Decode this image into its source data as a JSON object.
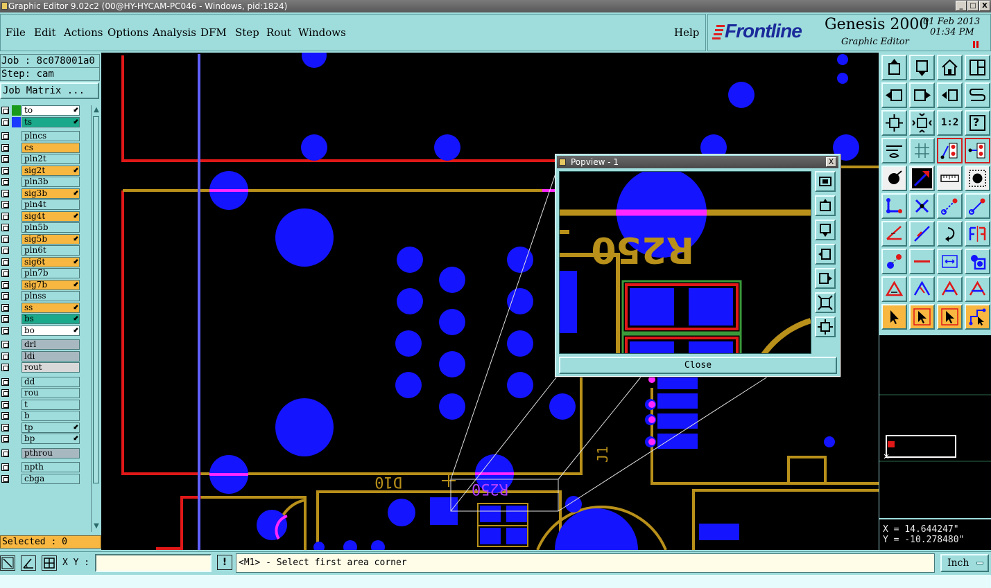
{
  "window": {
    "title": "Graphic Editor 9.02c2 (00@HY-HYCAM-PC046 - Windows, pid:1824)",
    "min_label": "_",
    "max_label": "□",
    "close_label": "X"
  },
  "menu": {
    "file": "File",
    "edit": "Edit",
    "actions": "Actions",
    "options": "Options",
    "analysis": "Analysis",
    "dfm": "DFM",
    "step": "Step",
    "rout": "Rout",
    "windows": "Windows",
    "help": "Help"
  },
  "brand": {
    "logo": "Frontline",
    "product": "Genesis 2000",
    "subtitle": "Graphic Editor",
    "date": "01 Feb 2013",
    "time": "01:34 PM"
  },
  "job": {
    "job_line": "Job : 8c078001a0",
    "step_line": "Step: cam",
    "matrix_button": "Job Matrix ..."
  },
  "layers": [
    {
      "name": "to",
      "color": "#ffffff",
      "swatch": "#1a9a1a",
      "arrow": true
    },
    {
      "name": "ts",
      "color": "#1aa98a",
      "swatch": "#1a3aff",
      "arrow": true
    },
    {
      "name": "plncs",
      "color": "#9fdcdc",
      "swatch": "",
      "arrow": false
    },
    {
      "name": "cs",
      "color": "#f7b740",
      "swatch": "",
      "arrow": false
    },
    {
      "name": "pln2t",
      "color": "#9fdcdc",
      "swatch": "",
      "arrow": false
    },
    {
      "name": "sig2t",
      "color": "#f7b740",
      "swatch": "",
      "arrow": true
    },
    {
      "name": "pln3b",
      "color": "#9fdcdc",
      "swatch": "",
      "arrow": false
    },
    {
      "name": "sig3b",
      "color": "#f7b740",
      "swatch": "",
      "arrow": true
    },
    {
      "name": "pln4t",
      "color": "#9fdcdc",
      "swatch": "",
      "arrow": false
    },
    {
      "name": "sig4t",
      "color": "#f7b740",
      "swatch": "",
      "arrow": true
    },
    {
      "name": "pln5b",
      "color": "#9fdcdc",
      "swatch": "",
      "arrow": false
    },
    {
      "name": "sig5b",
      "color": "#f7b740",
      "swatch": "",
      "arrow": true
    },
    {
      "name": "pln6t",
      "color": "#9fdcdc",
      "swatch": "",
      "arrow": false
    },
    {
      "name": "sig6t",
      "color": "#f7b740",
      "swatch": "",
      "arrow": true
    },
    {
      "name": "pln7b",
      "color": "#9fdcdc",
      "swatch": "",
      "arrow": false
    },
    {
      "name": "sig7b",
      "color": "#f7b740",
      "swatch": "",
      "arrow": true
    },
    {
      "name": "plnss",
      "color": "#9fdcdc",
      "swatch": "",
      "arrow": false
    },
    {
      "name": "ss",
      "color": "#f7b740",
      "swatch": "",
      "arrow": true
    },
    {
      "name": "bs",
      "color": "#1aa98a",
      "swatch": "",
      "arrow": true
    },
    {
      "name": "bo",
      "color": "#ffffff",
      "swatch": "",
      "arrow": true
    },
    {
      "name": "drl",
      "color": "#a8b8c0",
      "swatch": "",
      "arrow": false
    },
    {
      "name": "ldi",
      "color": "#a8b8c0",
      "swatch": "",
      "arrow": false
    },
    {
      "name": "rout",
      "color": "#d8d8d8",
      "swatch": "",
      "arrow": false
    },
    {
      "name": "dd",
      "color": "#9fdcdc",
      "swatch": "",
      "arrow": false
    },
    {
      "name": "rou",
      "color": "#9fdcdc",
      "swatch": "",
      "arrow": false
    },
    {
      "name": "t",
      "color": "#9fdcdc",
      "swatch": "",
      "arrow": false
    },
    {
      "name": "b",
      "color": "#9fdcdc",
      "swatch": "",
      "arrow": false
    },
    {
      "name": "tp",
      "color": "#9fdcdc",
      "swatch": "",
      "arrow": true
    },
    {
      "name": "bp",
      "color": "#9fdcdc",
      "swatch": "",
      "arrow": true
    },
    {
      "name": "pthrou",
      "color": "#a8b8c0",
      "swatch": "",
      "arrow": false
    },
    {
      "name": "npth",
      "color": "#9fdcdc",
      "swatch": "",
      "arrow": false
    },
    {
      "name": "cbga",
      "color": "#9fdcdc",
      "swatch": "",
      "arrow": false
    }
  ],
  "selected_label": "Selected : 0",
  "canvas_labels": {
    "d10": "D10",
    "r250": "R250",
    "j1": "J1"
  },
  "popview": {
    "title": "Popview - 1",
    "close_button": "Close",
    "close_x": "X",
    "r250": "R250"
  },
  "coords": {
    "x": "X = 14.644247\"",
    "y": "Y = -10.278480\""
  },
  "toolbar": {
    "one_to_two": "1:2",
    "help": "?"
  },
  "status": {
    "xy_label": "X Y :",
    "xy_value": "",
    "warn": "!",
    "prompt": "<M1> - Select first area corner",
    "unit": "Inch"
  },
  "colors": {
    "cyan_bg": "#9fdcdc",
    "pad_blue": "#1414ff",
    "trace_gold": "#b8901a",
    "trace_red": "#e01818",
    "highlight_magenta": "#ff28ff",
    "layer_orange": "#f7b740"
  }
}
